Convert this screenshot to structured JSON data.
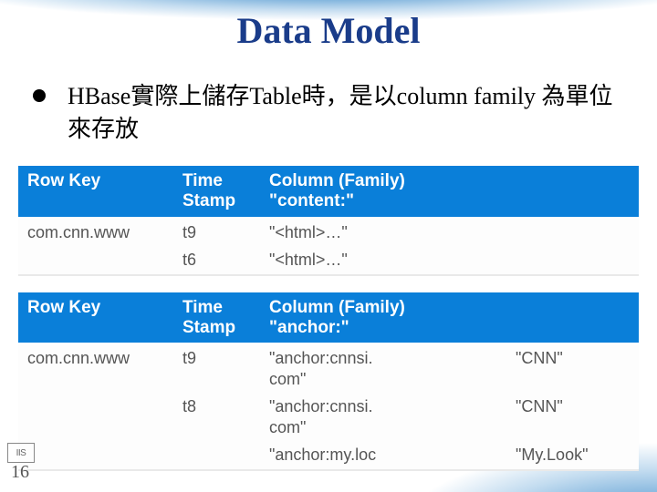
{
  "title": "Data Model",
  "bullet": "HBase實際上儲存Table時，是以column family 為單位來存放",
  "slide_number": "16",
  "logo_label": "IIS",
  "table1": {
    "headers": {
      "row_key": "Row Key",
      "time_stamp": "Time\nStamp",
      "column_family": "Column (Family)\n\"content:\""
    },
    "rows": [
      {
        "row_key": "com.cnn.www",
        "ts": "t9",
        "cf": "\"<html>…\""
      },
      {
        "row_key": "",
        "ts": "t6",
        "cf": "\"<html>…\""
      }
    ]
  },
  "table2": {
    "headers": {
      "row_key": "Row Key",
      "time_stamp": "Time\nStamp",
      "column_family": "Column (Family)\n\"anchor:\""
    },
    "rows": [
      {
        "row_key": "com.cnn.www",
        "ts": "t9",
        "cf1": "\"anchor:cnnsi.\ncom\"",
        "cf2": "\"CNN\""
      },
      {
        "row_key": "",
        "ts": "t8",
        "cf1": "\"anchor:cnnsi.\ncom\"",
        "cf2": "\"CNN\""
      },
      {
        "row_key": "",
        "ts": "",
        "cf1": "\"anchor:my.loc",
        "cf2": "\"My.Look\""
      }
    ]
  }
}
